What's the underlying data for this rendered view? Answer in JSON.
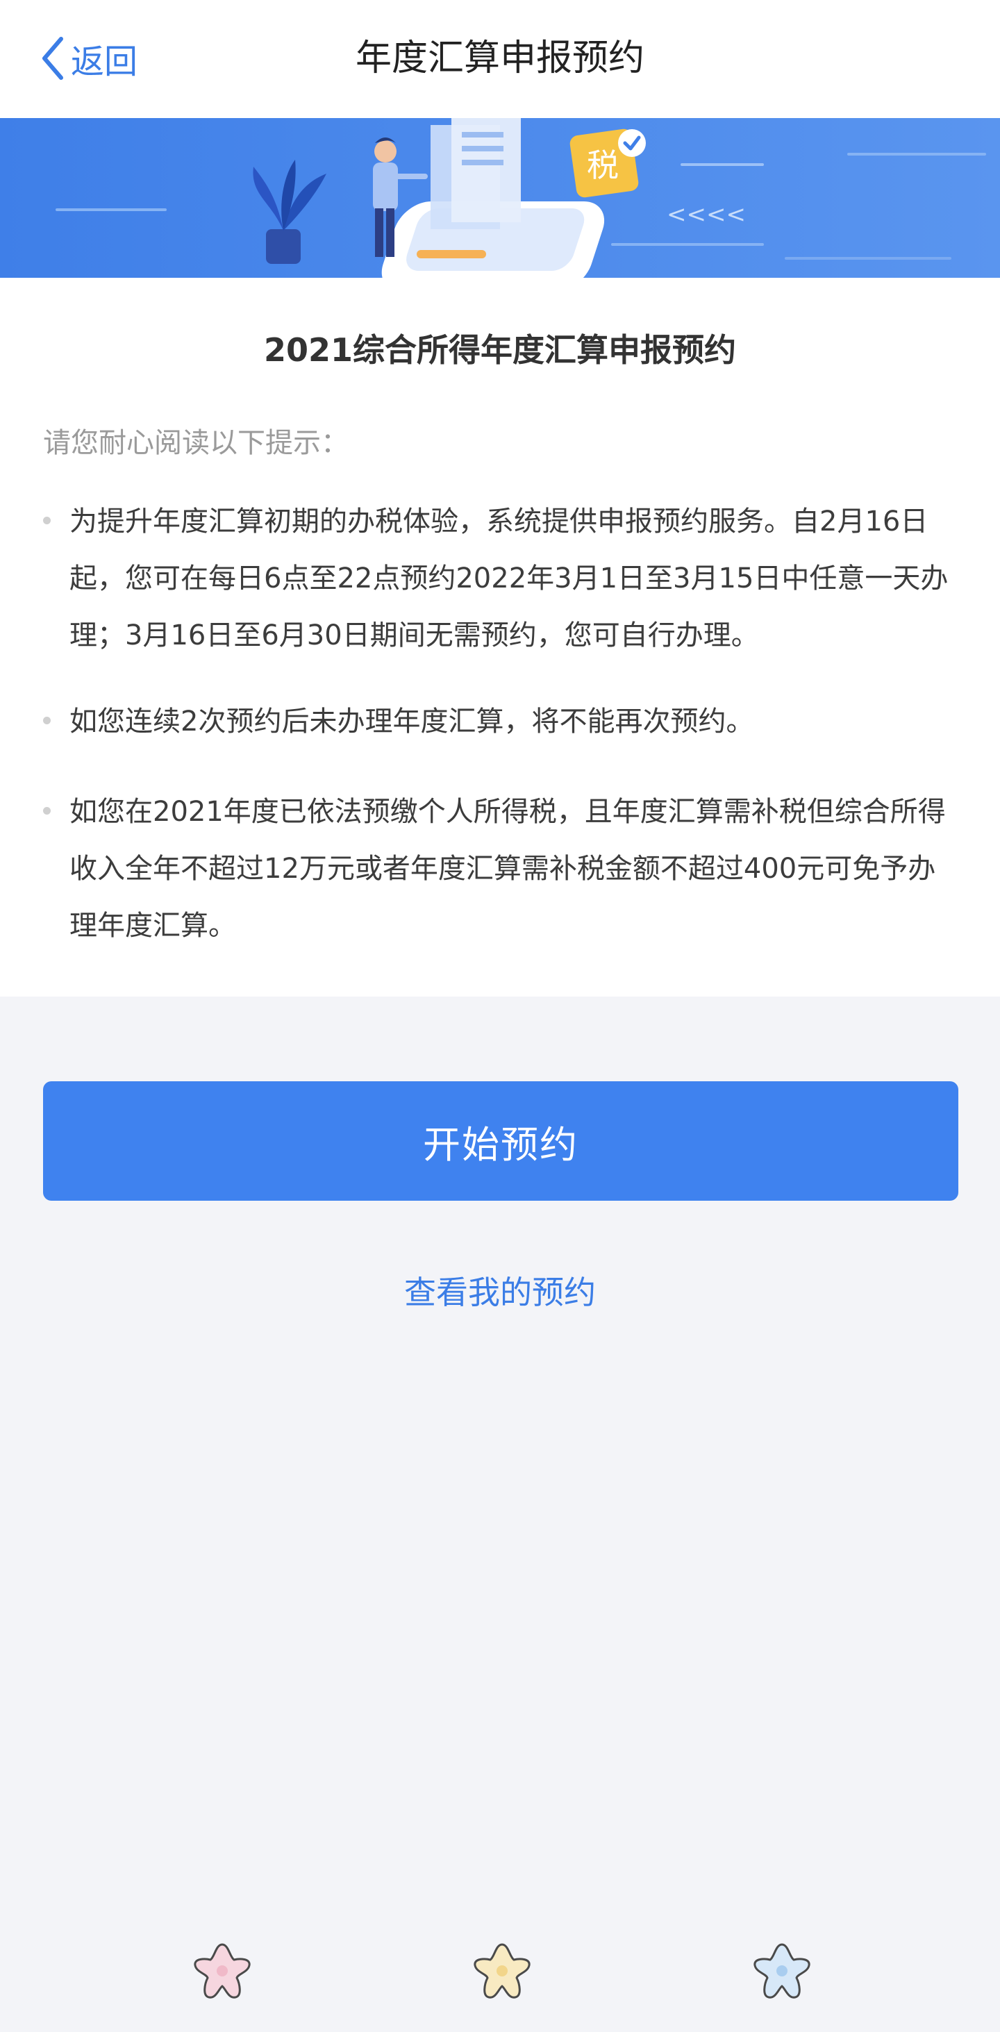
{
  "nav": {
    "back_label": "返回",
    "title": "年度汇算申报预约"
  },
  "banner": {
    "tax_badge": "税",
    "arrows": "<<<<"
  },
  "content": {
    "heading": "2021综合所得年度汇算申报预约",
    "hint_intro": "请您耐心阅读以下提示：",
    "notices": [
      "为提升年度汇算初期的办税体验，系统提供申报预约服务。自2月16日起，您可在每日6点至22点预约2022年3月1日至3月15日中任意一天办理；3月16日至6月30日期间无需预约，您可自行办理。",
      "如您连续2次预约后未办理年度汇算，将不能再次预约。",
      "如您在2021年度已依法预缴个人所得税，且年度汇算需补税但综合所得收入全年不超过12万元或者年度汇算需补税金额不超过400元可免予办理年度汇算。"
    ]
  },
  "actions": {
    "start_label": "开始预约",
    "my_appointments_label": "查看我的预约"
  },
  "colors": {
    "accent": "#3f82ef",
    "link": "#3b7de6",
    "banner_bg": "#4a86ea",
    "page_bg": "#f3f4f8"
  },
  "icons": {
    "back": "chevron-left-icon",
    "decorations": [
      "pink-flower-icon",
      "yellow-flower-icon",
      "blue-flower-icon"
    ]
  }
}
